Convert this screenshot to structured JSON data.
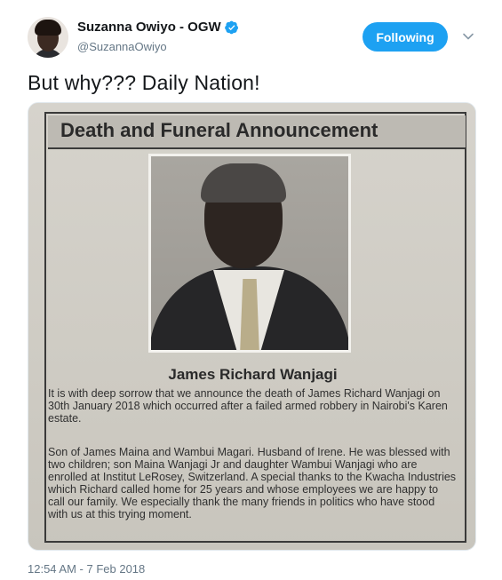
{
  "user": {
    "display_name": "Suzanna Owiyo - OGW",
    "handle": "@SuzannaOwiyo",
    "verified": true
  },
  "header": {
    "follow_label": "Following",
    "more_icon": "chevron-down-icon"
  },
  "tweet": {
    "text": "But why??? Daily Nation!",
    "timestamp": "12:54 AM - 7 Feb 2018"
  },
  "media": {
    "headline": "Death and Funeral Announcement",
    "person_name": "James Richard Wanjagi",
    "paragraph_1": "It is with deep sorrow that we announce the death of James Richard Wanjagi on 30th January 2018 which occurred after a failed armed robbery in Nairobi's Karen estate.",
    "paragraph_2": "Son of James Maina and Wambui Magari. Husband of Irene. He was blessed with two children; son Maina Wanjagi Jr and daughter Wambui Wanjagi who are enrolled at Institut LeRosey, Switzerland. A special thanks to the Kwacha Industries which Richard called home for 25 years and whose employees we are happy to call our family. We especially thank the many friends in politics who have stood with us at this trying moment."
  },
  "colors": {
    "accent": "#1da1f2",
    "text": "#14171a",
    "secondary_text": "#657786"
  }
}
